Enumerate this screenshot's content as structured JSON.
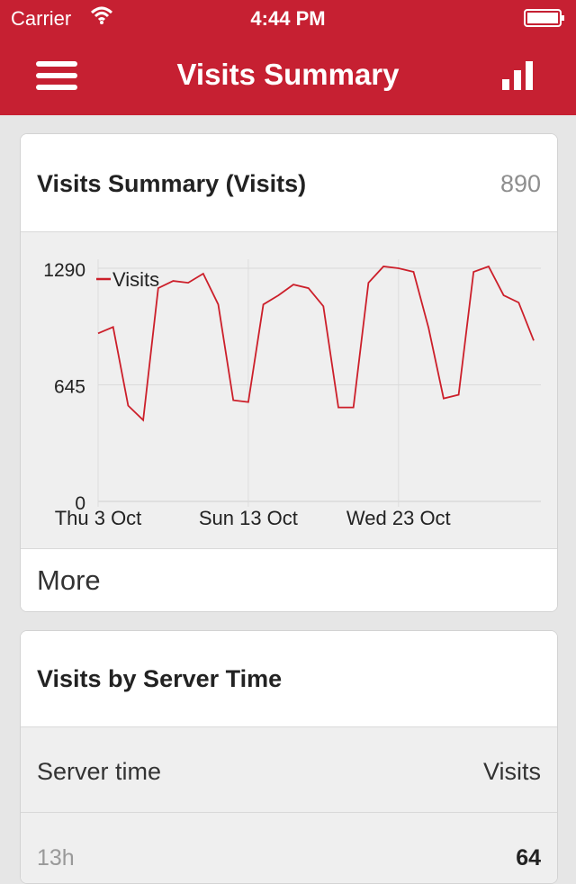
{
  "status_bar": {
    "carrier": "Carrier",
    "time": "4:44 PM",
    "icons": [
      "wifi-icon",
      "battery-icon"
    ]
  },
  "nav": {
    "title": "Visits Summary",
    "icons": [
      "menu-icon",
      "bar-chart-icon"
    ]
  },
  "colors": {
    "brand": "#c62032",
    "series": "#cc1f2a",
    "chart_bg": "#efefef"
  },
  "visits_card": {
    "title": "Visits Summary (Visits)",
    "value": "890",
    "more_label": "More"
  },
  "chart_data": {
    "type": "line",
    "series": [
      {
        "name": "Visits",
        "values": [
          930,
          965,
          530,
          450,
          1180,
          1220,
          1210,
          1260,
          1090,
          560,
          550,
          1090,
          1140,
          1200,
          1180,
          1080,
          520,
          520,
          1210,
          1300,
          1290,
          1270,
          960,
          570,
          590,
          1270,
          1300,
          1140,
          1100,
          890
        ]
      }
    ],
    "x_labels": [
      "Thu 3 Oct",
      "Sun 13 Oct",
      "Wed 23 Oct"
    ],
    "x_label_indices": [
      0,
      10,
      20
    ],
    "y_ticks": [
      "1290",
      "645",
      "0"
    ],
    "ylim": [
      0,
      1290
    ],
    "grid": true,
    "legend": "top-left"
  },
  "server_time_card": {
    "title": "Visits by Server Time",
    "col_left": "Server time",
    "col_right": "Visits",
    "rows": [
      {
        "label": "13h",
        "value": "64"
      }
    ]
  }
}
